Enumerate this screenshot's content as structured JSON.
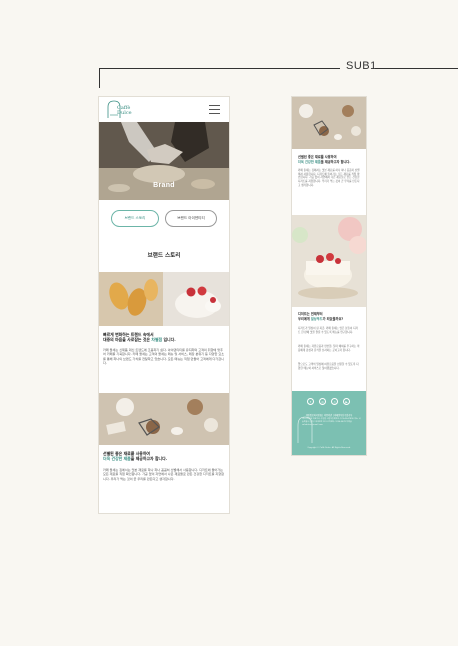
{
  "page": {
    "section_label": "SUB1"
  },
  "left_phone": {
    "logo_text_1": "Caffè",
    "logo_text_2": "Dulce",
    "hero_title": "Brand",
    "tabs": [
      {
        "label": "브랜드 스토리",
        "active": true
      },
      {
        "label": "브랜드 아이덴티티",
        "active": false
      }
    ],
    "section_title": "브랜드 스토리",
    "block1": {
      "heading_line1": "빠르게 변화하는 트렌드 속에서",
      "heading_pre": "대중의 마음을 사로잡는 것은 ",
      "heading_accent": "차별점",
      "heading_post": " 입니다.",
      "body": "카페 둘세는 신제품 대신 트렌드에 조응하기 쉽다. 아이덴티티를 유지하며 고객의 취향에 맞추어 카페를 기획합니다. 카페 둘세는 고객의 둘세는 메뉴 및 서비스, 매장 분위기 등 다양한 요소를 통해 하나의 브랜드 가치를 전달하고 있습니다. 모든 메뉴는 직접 만들어 고객에게 다가갑니다."
    },
    "block2": {
      "heading_line1": "선별된 좋은 재료를 사용하여",
      "heading_accent": "더욱 건강한 제품",
      "heading_post": "을 제공하고자 합니다.",
      "body": "카페 둘세는 집에서는 맛본 재료를 하나 하나 꼼꼼히 선별해서 사용합니다. 디저트에 들어가는 모든 재료를 직접 확인합니다. 가공 없이 자연에서 나온 재료들로 만든 건강한 디저트를 지향합니다. 우리가 먹는 것이 곧 우리를 만든다고 생각합니다."
    }
  },
  "right_phone": {
    "block1": {
      "heading_line1": "선별된 좋은 재료를 사용하여",
      "heading_accent": "더욱 건강한 제품",
      "heading_post": "을 제공하고자 합니다.",
      "body": "카페 둘세는 집에서는 맛본 재료를 하나 하나 꼼꼼히 선별해서 사용합니다. 디저트에 들어가는 모든 재료를 직접 확인합니다. 가공 없이 자연에서 나온 재료들로 만든 건강한 디저트를 지향합니다. 우리가 먹는 것이 곧 우리를 만든다고 생각합니다."
    },
    "block2": {
      "heading_line1": "디저트는 먼제부터",
      "heading_pre": "우리에게 ",
      "heading_accent": "일상푸드",
      "heading_post": "가 되었을까요?",
      "body1": "디저트가 일상이 된 지금, 카페 둘세는 많은 분들이 디저트 한 판에 맛을 즐길 수 있도록 메뉴를 연구합니다.",
      "body2": "카페 둘세는 자유로움과 편안함, 달라 예외를 추구하는 마음에게 감성과 휴식을 선사하는 곳이고자 합니다.",
      "body3": "앞으로도 고객의 일상에 여유로움을 선물할 수 있도록 다양한 메뉴와 서비스로 찾아뵙겠습니다."
    },
    "footer": {
      "sns": [
        "f",
        "◎",
        "♫",
        "▶"
      ],
      "links": "개인정보처리방침 | 이용약관 | 이메일무단수집거부",
      "info": "(주)카페둘세 대표이사: 홍길동 사업자등록번호: 123-45-67890 주소: 서울특별시 강남구 테헤란로 123 고객센터: 1234-5678 이메일: cafedulce@email.com",
      "copyright": "Copyright © Caffè Dulce. All Rights Reserved.",
      "logo_text_1": "Caffè",
      "logo_text_2": "Dulce"
    }
  }
}
